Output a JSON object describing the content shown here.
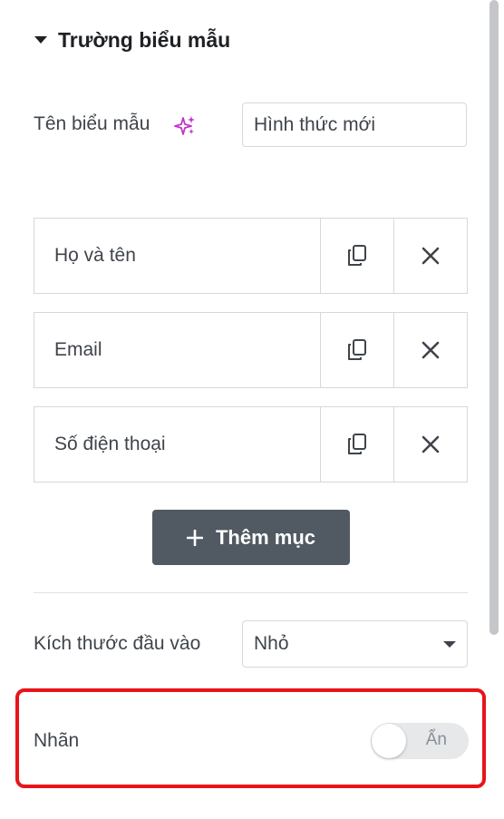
{
  "section": {
    "title": "Trường biểu mẫu"
  },
  "form_name": {
    "label": "Tên biểu mẫu",
    "value": "Hình thức mới"
  },
  "fields": [
    {
      "label": "Họ và tên"
    },
    {
      "label": "Email"
    },
    {
      "label": "Số điện thoại"
    }
  ],
  "add_item": {
    "label": "Thêm mục"
  },
  "input_size": {
    "label": "Kích thước đầu vào",
    "selected": "Nhỏ"
  },
  "label_toggle": {
    "label": "Nhãn",
    "state_text": "Ẩn"
  },
  "icons": {
    "section_toggle": "caret-down-icon",
    "ai": "sparkle-icon",
    "duplicate": "copy-icon",
    "remove": "close-icon",
    "add": "plus-icon",
    "dropdown": "chevron-down-icon"
  },
  "colors": {
    "accent_ai": "#c036c9",
    "button_bg": "#515962",
    "highlight": "#e8141a"
  }
}
